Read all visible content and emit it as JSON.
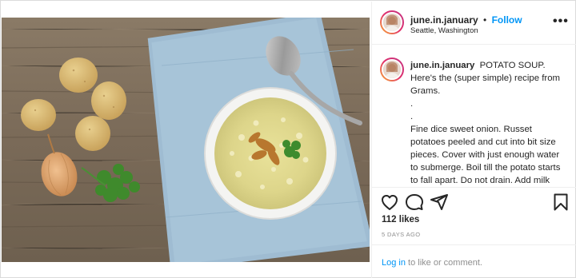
{
  "post": {
    "username": "june.in.january",
    "separator": "•",
    "follow_label": "Follow",
    "location": "Seattle, Washington",
    "more_label": "•••",
    "caption": {
      "username": "june.in.january",
      "text": "POTATO SOUP. Here's the (super simple) recipe from Grams.\n.\n.\nFine dice sweet onion. Russet potatoes peeled and cut into bit size pieces. Cover with just enough water to submerge. Boil till the potato starts to fall apart. Do not drain. Add milk and or half n half to desired consistency, heat through but do not boil. Add"
    },
    "likes": "112 likes",
    "timestamp": "5 DAYS AGO",
    "login": {
      "link": "Log in",
      "rest": " to like or comment."
    }
  },
  "icons": {
    "like": "heart-icon",
    "comment": "comment-icon",
    "share": "paper-plane-icon",
    "save": "bookmark-icon"
  },
  "colors": {
    "accent": "#0095f6",
    "muted": "#8e8e8e",
    "border": "#dbdbdb"
  }
}
